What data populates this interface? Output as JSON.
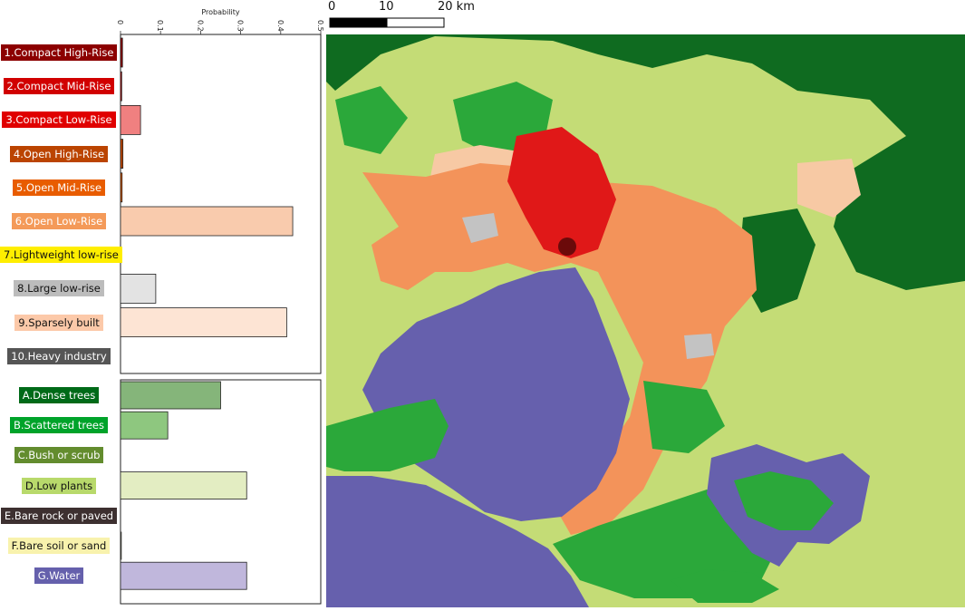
{
  "chart_data": {
    "type": "bar",
    "orientation": "horizontal",
    "xlabel": "Probability",
    "xlim": [
      0,
      0.5
    ],
    "ticks": [
      "0",
      "0.1",
      "0.2",
      "0.3",
      "0.4",
      "0.5"
    ],
    "tick_values": [
      0,
      0.1,
      0.2,
      0.3,
      0.4,
      0.5
    ],
    "panels": [
      {
        "name": "built",
        "categories": [
          {
            "label": "1.Compact High-Rise",
            "value": 0.005,
            "bg": "#8c0000",
            "fg": "#ffffff",
            "fill": "#8c0000"
          },
          {
            "label": "2.Compact Mid-Rise",
            "value": 0.003,
            "bg": "#d10000",
            "fg": "#ffffff",
            "fill": "#d10000"
          },
          {
            "label": "3.Compact Low-Rise",
            "value": 0.05,
            "bg": "#e00000",
            "fg": "#ffffff",
            "fill": "#f08080"
          },
          {
            "label": "4.Open High-Rise",
            "value": 0.006,
            "bg": "#bb4400",
            "fg": "#ffffff",
            "fill": "#bb4400"
          },
          {
            "label": "5.Open Mid-Rise",
            "value": 0.004,
            "bg": "#e85c00",
            "fg": "#ffffff",
            "fill": "#e85c00"
          },
          {
            "label": "6.Open Low-Rise",
            "value": 0.43,
            "bg": "#f49a59",
            "fg": "#ffffff",
            "fill": "#f9cbad"
          },
          {
            "label": "7.Lightweight low-rise",
            "value": 0.0,
            "bg": "#ffee00",
            "fg": "#111111",
            "fill": "#ffee00"
          },
          {
            "label": "8.Large low-rise",
            "value": 0.088,
            "bg": "#bcbcbc",
            "fg": "#111111",
            "fill": "#e3e3e3"
          },
          {
            "label": "9.Sparsely built",
            "value": 0.415,
            "bg": "#fcc9a9",
            "fg": "#111111",
            "fill": "#fde4d4"
          },
          {
            "label": "10.Heavy industry",
            "value": 0.0,
            "bg": "#555555",
            "fg": "#ffffff",
            "fill": "#555555"
          }
        ]
      },
      {
        "name": "land-cover",
        "categories": [
          {
            "label": "A.Dense trees",
            "value": 0.25,
            "bg": "#006a18",
            "fg": "#ffffff",
            "fill": "#85b57a"
          },
          {
            "label": "B.Scattered trees",
            "value": 0.118,
            "bg": "#00a32a",
            "fg": "#ffffff",
            "fill": "#8ec77f"
          },
          {
            "label": "C.Bush or scrub",
            "value": 0.0,
            "bg": "#638c2e",
            "fg": "#ffffff",
            "fill": "#638c2e"
          },
          {
            "label": "D.Low plants",
            "value": 0.315,
            "bg": "#b8d96b",
            "fg": "#111111",
            "fill": "#e3edc2"
          },
          {
            "label": "E.Bare rock or paved",
            "value": 0.0,
            "bg": "#3d3030",
            "fg": "#ffffff",
            "fill": "#3d3030"
          },
          {
            "label": "F.Bare soil or sand",
            "value": 0.002,
            "bg": "#f8f2ad",
            "fg": "#111111",
            "fill": "#f8f2ad"
          },
          {
            "label": "G.Water",
            "value": 0.315,
            "bg": "#6560ac",
            "fg": "#ffffff",
            "fill": "#c0b7dc"
          }
        ]
      }
    ]
  },
  "scalebar": {
    "labels": [
      "0",
      "10",
      "20 km"
    ],
    "values_km": [
      0,
      10,
      20
    ]
  },
  "map": {
    "colors": {
      "dense_trees": "#0f6b20",
      "scattered_trees": "#2ba83a",
      "low_plants": "#c4dc76",
      "sparsely_built": "#f7c9a4",
      "open_low_rise": "#f3935a",
      "compact_low_rise": "#e01818",
      "compact_high_rise": "#6b0a0a",
      "large_low_rise": "#c3c3c3",
      "water": "#6660ad",
      "heavy_industry": "#555555"
    }
  }
}
